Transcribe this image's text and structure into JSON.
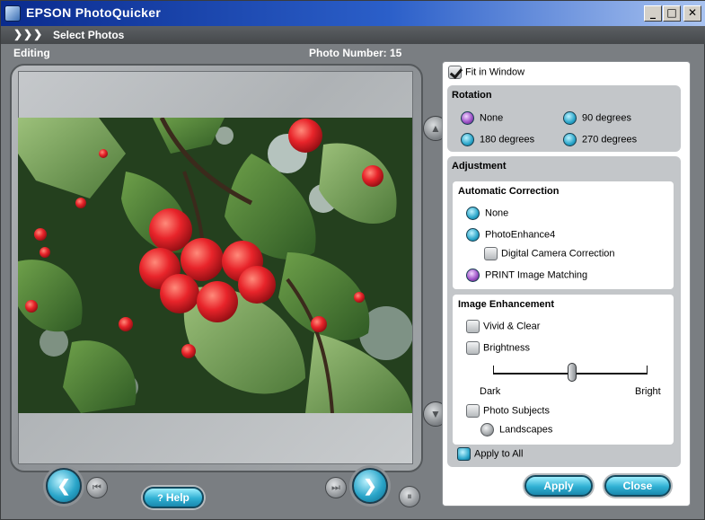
{
  "window": {
    "title": "EPSON PhotoQuicker",
    "min": "_",
    "max": "□",
    "close": "✕"
  },
  "step": {
    "arrows": "❯❯❯",
    "label": "Select Photos"
  },
  "info": {
    "mode": "Editing",
    "photo_number": "Photo Number: 15"
  },
  "panel": {
    "fit_in_window": {
      "label": "Fit in Window",
      "checked": true
    },
    "rotation": {
      "title": "Rotation",
      "options": [
        "None",
        "90 degrees",
        "180 degrees",
        "270 degrees"
      ],
      "selected": "None"
    },
    "adjustment": {
      "title": "Adjustment",
      "automatic": {
        "title": "Automatic Correction",
        "none": "None",
        "photoenhance": "PhotoEnhance4",
        "digital_camera": "Digital Camera Correction",
        "print_matching": "PRINT Image Matching",
        "selected": "PRINT Image Matching"
      },
      "enhancement": {
        "title": "Image Enhancement",
        "vivid": "Vivid & Clear",
        "brightness": "Brightness",
        "dark": "Dark",
        "bright": "Bright",
        "brightness_level": 0.5,
        "photo_subjects": "Photo Subjects",
        "landscapes": "Landscapes"
      },
      "apply_all": "Apply to All"
    }
  },
  "buttons": {
    "help": "Help",
    "apply": "Apply",
    "close": "Close"
  },
  "colors": {
    "accent": "#2aa5c9",
    "title_start": "#0a2b8e",
    "selected_radio": "#a055c9"
  }
}
